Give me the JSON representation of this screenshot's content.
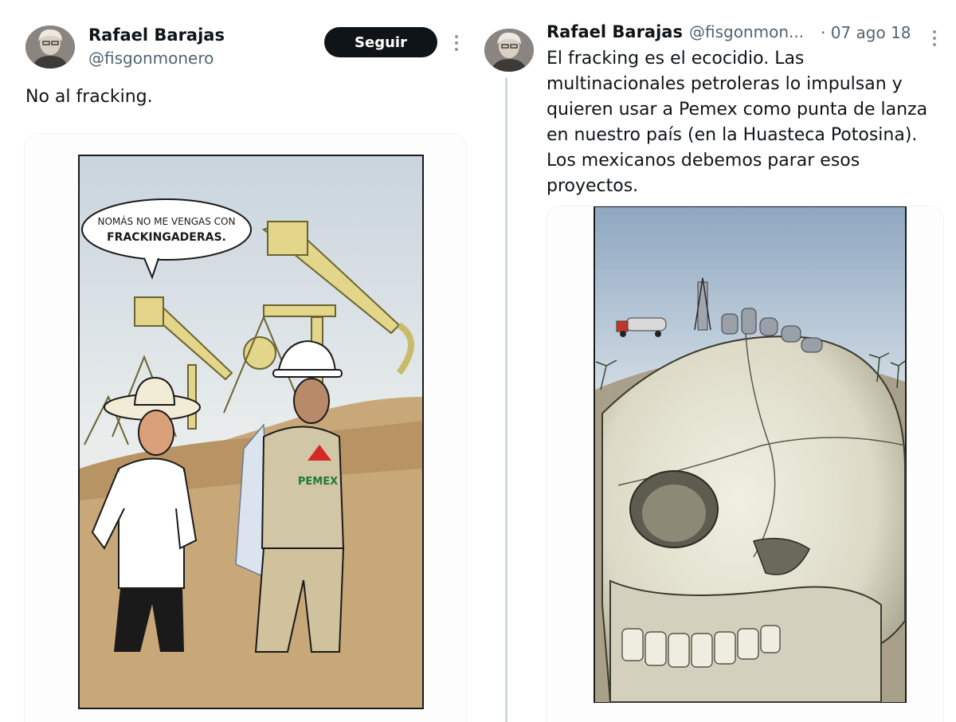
{
  "left_tweet": {
    "author_name": "Rafael Barajas",
    "author_handle": "@fisgonmonero",
    "follow_label": "Seguir",
    "text": "No al fracking.",
    "cartoon": {
      "speech_bubble_line1": "NOMÁS NO ME VENGAS CON",
      "speech_bubble_line2": "FRACKINGADERAS.",
      "logo_text": "PEMEX"
    }
  },
  "right_tweet": {
    "author_name": "Rafael Barajas",
    "author_handle": "@fisgonmon...",
    "date": "· 07 ago 18",
    "text_lines": [
      "El fracking es el ecocidio. Las",
      "multinacionales petroleras lo impulsan y",
      "quieren usar a Pemex como punta de lanza",
      "en nuestro país (en la Huasteca Potosina).",
      "Los mexicanos debemos parar esos",
      "proyectos."
    ]
  },
  "colors": {
    "follow_button_bg": "#0f1419",
    "handle_gray": "#536471",
    "pemex_red": "#d62828",
    "pemex_green": "#1e7a3a"
  }
}
